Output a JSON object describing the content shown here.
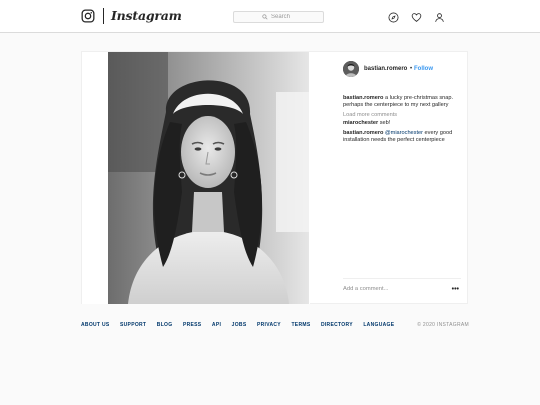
{
  "header": {
    "brand": "Instagram",
    "search_placeholder": "Search"
  },
  "post": {
    "username": "bastian.romero",
    "separator": "•",
    "follow_label": "Follow",
    "caption_user": "bastian.romero",
    "caption_text": " a lucky pre-christmas snap. perhaps the centerpiece to my next gallery",
    "load_more": "Load more comments",
    "comments": [
      {
        "user": "miarochester",
        "text": " seb!"
      },
      {
        "user": "bastian.romero",
        "mention": " @miarochester",
        "text": " every good installation needs the perfect centerpiece"
      }
    ],
    "comment_placeholder": "Add a comment...",
    "more_label": "•••"
  },
  "footer": {
    "links": [
      "ABOUT US",
      "SUPPORT",
      "BLOG",
      "PRESS",
      "API",
      "JOBS",
      "PRIVACY",
      "TERMS",
      "DIRECTORY",
      "LANGUAGE"
    ],
    "copyright": "© 2020 INSTAGRAM"
  },
  "colors": {
    "link_blue": "#3897f0",
    "footer_link": "#00376b",
    "muted": "#8e8e8e",
    "border": "#dbdbdb"
  },
  "icons": [
    "instagram-glyph-icon",
    "search-icon",
    "compass-icon",
    "heart-icon",
    "profile-icon"
  ]
}
